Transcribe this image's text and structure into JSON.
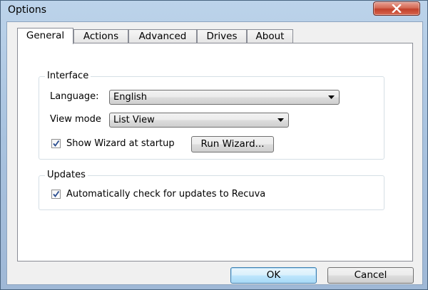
{
  "window": {
    "title": "Options"
  },
  "tabs": [
    {
      "label": "General",
      "active": true
    },
    {
      "label": "Actions",
      "active": false
    },
    {
      "label": "Advanced",
      "active": false
    },
    {
      "label": "Drives",
      "active": false
    },
    {
      "label": "About",
      "active": false
    }
  ],
  "interface": {
    "group_label": "Interface",
    "language_label": "Language:",
    "language_value": "English",
    "view_mode_label": "View mode",
    "view_mode_value": "List View",
    "show_wizard_label": "Show Wizard at startup",
    "show_wizard_checked": true,
    "run_wizard_label": "Run Wizard..."
  },
  "updates": {
    "group_label": "Updates",
    "auto_check_label": "Automatically check for updates to Recuva",
    "auto_check_checked": true
  },
  "footer": {
    "ok_label": "OK",
    "cancel_label": "Cancel"
  },
  "icons": {
    "close": "close-icon",
    "dropdown": "chevron-down-icon",
    "check": "checkmark-icon"
  },
  "colors": {
    "close_button": "#c2412a",
    "default_button_border": "#3c7fb1",
    "checkmark": "#2a4d8f"
  }
}
